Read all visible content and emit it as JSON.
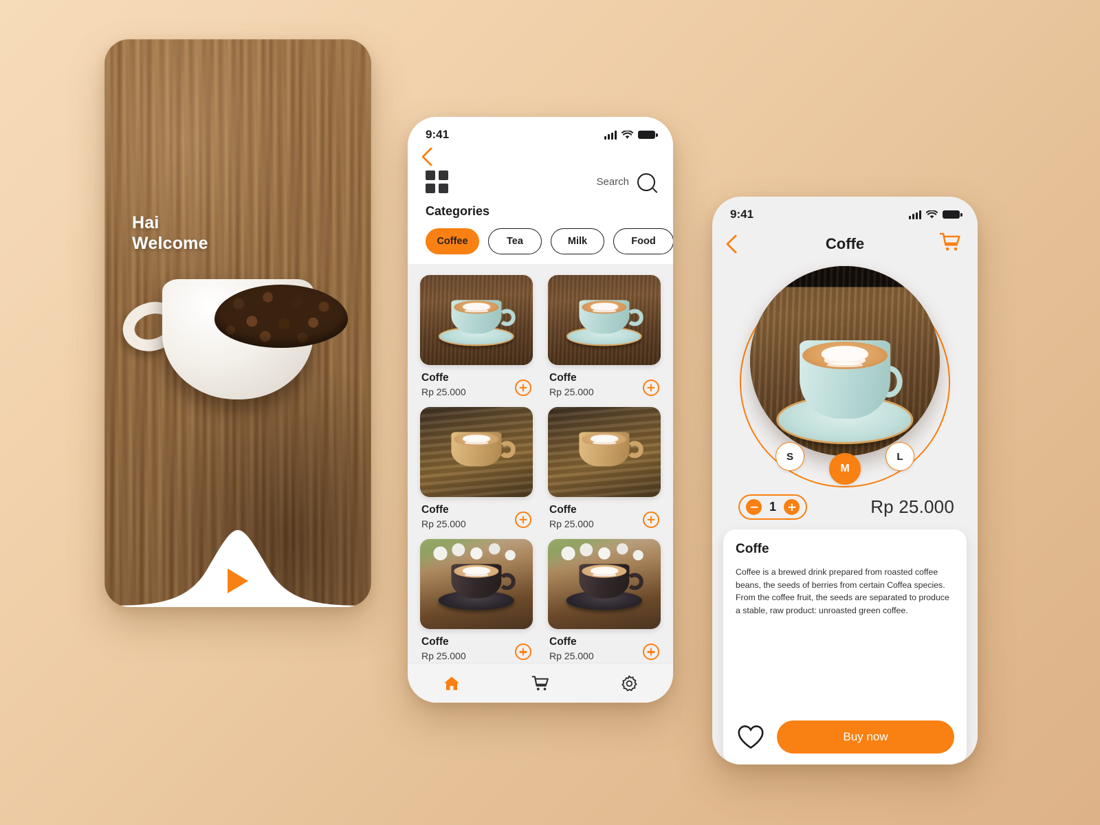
{
  "theme": {
    "accent": "#f98012",
    "bg_beige": "#e5bf96",
    "screen_gray": "#f1f0f0",
    "dark_text": "#1c1c1e"
  },
  "welcome_screen": {
    "greeting_line1": "Hai",
    "greeting_line2": "Welcome",
    "play_button_label": "▶"
  },
  "list_screen": {
    "status": {
      "time": "9:41",
      "signal_icon": "cellular-bars-icon",
      "wifi_icon": "wifi-icon",
      "battery_icon": "battery-icon"
    },
    "back_icon": "chevron-left-icon",
    "grid_icon": "grid-menu-icon",
    "search_label": "Search",
    "search_icon": "search-icon",
    "categories_title": "Categories",
    "categories": [
      {
        "label": "Coffee",
        "active": true
      },
      {
        "label": "Tea",
        "active": false
      },
      {
        "label": "Milk",
        "active": false
      },
      {
        "label": "Food",
        "active": false
      }
    ],
    "products": [
      {
        "name": "Coffe",
        "price": "Rp 25.000",
        "add_icon": "plus-circle-icon"
      },
      {
        "name": "Coffe",
        "price": "Rp 25.000",
        "add_icon": "plus-circle-icon"
      },
      {
        "name": "Coffe",
        "price": "Rp 25.000",
        "add_icon": "plus-circle-icon"
      },
      {
        "name": "Coffe",
        "price": "Rp 25.000",
        "add_icon": "plus-circle-icon"
      },
      {
        "name": "Coffe",
        "price": "Rp 25.000",
        "add_icon": "plus-circle-icon"
      },
      {
        "name": "Coffe",
        "price": "Rp 25.000",
        "add_icon": "plus-circle-icon"
      }
    ],
    "tabs": [
      {
        "icon": "home-icon",
        "active": true
      },
      {
        "icon": "cart-icon",
        "active": false
      },
      {
        "icon": "settings-gear-icon",
        "active": false
      }
    ]
  },
  "detail_screen": {
    "status": {
      "time": "9:41",
      "signal_icon": "cellular-bars-icon",
      "wifi_icon": "wifi-icon",
      "battery_icon": "battery-icon"
    },
    "back_icon": "chevron-left-icon",
    "title": "Coffe",
    "cart_icon": "cart-icon",
    "sizes": [
      {
        "label": "S",
        "selected": false
      },
      {
        "label": "M",
        "selected": true
      },
      {
        "label": "L",
        "selected": false
      }
    ],
    "quantity": "1",
    "minus_icon": "minus-circle-icon",
    "plus_icon": "plus-circle-icon",
    "price": "Rp 25.000",
    "description_title": "Coffe",
    "description_body": "Coffee is a brewed drink prepared from roasted coffee beans, the seeds of berries from certain Coffea species. From the coffee fruit, the seeds are separated to produce a stable, raw product: unroasted green coffee.",
    "favorite_icon": "heart-outline-icon",
    "buy_label": "Buy now"
  }
}
